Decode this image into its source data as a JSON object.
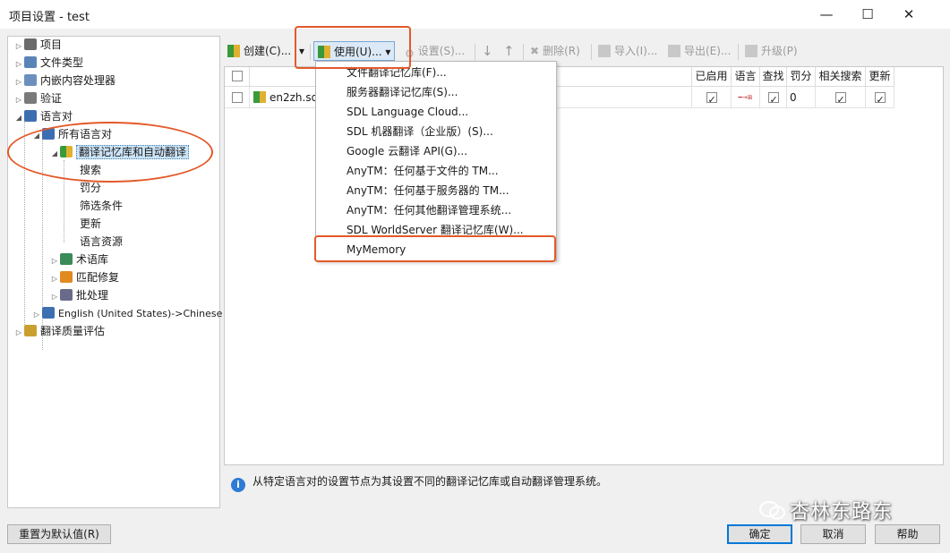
{
  "window": {
    "title": "项目设置 - test",
    "minimize": "—",
    "maximize": "☐",
    "close": "✕"
  },
  "tree": {
    "items": [
      {
        "label": "项目"
      },
      {
        "label": "文件类型"
      },
      {
        "label": "内嵌内容处理器"
      },
      {
        "label": "验证"
      },
      {
        "label": "语言对"
      },
      {
        "label": "所有语言对"
      },
      {
        "label": "翻译记忆库和自动翻译"
      },
      {
        "label": "搜索"
      },
      {
        "label": "罚分"
      },
      {
        "label": "筛选条件"
      },
      {
        "label": "更新"
      },
      {
        "label": "语言资源"
      },
      {
        "label": "术语库"
      },
      {
        "label": "匹配修复"
      },
      {
        "label": "批处理"
      },
      {
        "label": "English (United States)->Chinese ("
      },
      {
        "label": "翻译质量评估"
      }
    ]
  },
  "toolbar": {
    "create": "创建(C)...",
    "use": "使用(U)...",
    "settings": "设置(S)...",
    "delete": "删除(R)",
    "import": "导入(I)...",
    "export": "导出(E)...",
    "upgrade": "升级(P)"
  },
  "grid": {
    "columns": [
      "已启用",
      "语言",
      "查找",
      "罚分",
      "相关搜索",
      "更新"
    ],
    "row": {
      "name": "en2zh.sdlt",
      "penalty": "0",
      "lang_flag": "━→⊞"
    }
  },
  "menu": {
    "items": [
      "文件翻译记忆库(F)...",
      "服务器翻译记忆库(S)...",
      "SDL Language Cloud...",
      "SDL 机器翻译（企业版）(S)...",
      "Google 云翻译 API(G)...",
      "AnyTM：任何基于文件的 TM...",
      "AnyTM：任何基于服务器的 TM...",
      "AnyTM：任何其他翻译管理系统...",
      "SDL WorldServer 翻译记忆库(W)...",
      "MyMemory"
    ]
  },
  "info": {
    "text": "从特定语言对的设置节点为其设置不同的翻译记忆库或自动翻译管理系统。"
  },
  "buttons": {
    "reset": "重置为默认值(R)",
    "ok": "确定",
    "cancel": "取消",
    "help": "帮助"
  },
  "watermark": {
    "text": "杏林东路东"
  },
  "colors": {
    "highlight": "#e35a2a",
    "accent": "#0078d7",
    "selection": "#cce4f7"
  }
}
